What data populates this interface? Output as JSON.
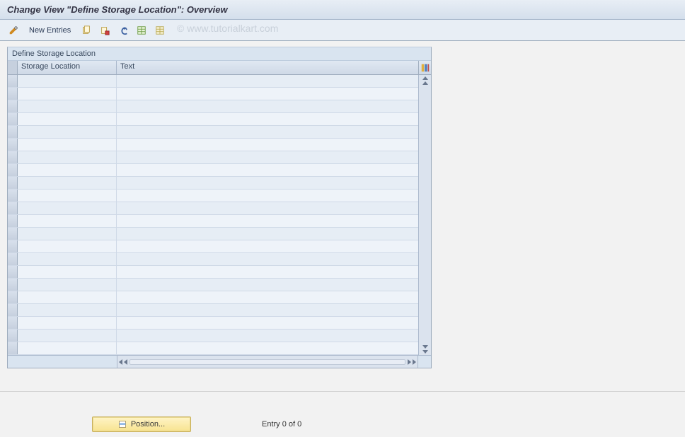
{
  "title": "Change View \"Define Storage Location\": Overview",
  "toolbar": {
    "new_entries_label": "New Entries"
  },
  "watermark": "© www.tutorialkart.com",
  "panel": {
    "title": "Define Storage Location",
    "columns": {
      "col1": "Storage Location",
      "col2": "Text"
    }
  },
  "position_button": {
    "label": "Position..."
  },
  "entry_status": "Entry 0 of 0"
}
